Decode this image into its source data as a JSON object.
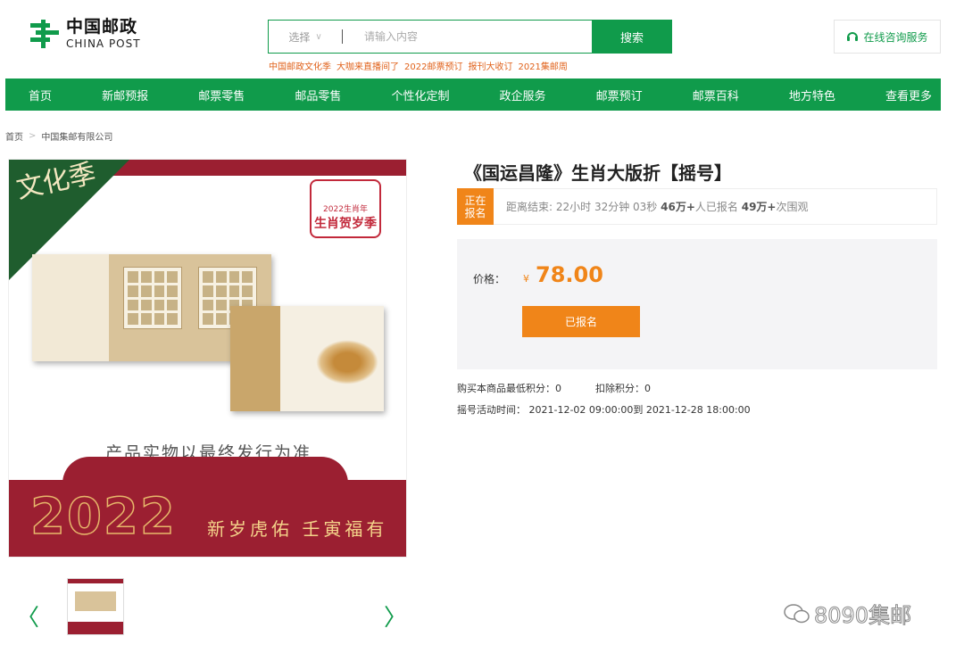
{
  "colors": {
    "brand_green": "#109b4b",
    "accent_orange": "#f08519",
    "hot_link": "#e0621b",
    "stamp_red": "#9b1f31"
  },
  "logo": {
    "cn": "中国邮政",
    "en": "CHINA POST"
  },
  "search": {
    "select_label": "选择",
    "placeholder": "请输入内容",
    "button": "搜索"
  },
  "hot_links": [
    "中国邮政文化季",
    "大咖来直播间了",
    "2022邮票预订",
    "报刊大收订",
    "2021集邮周"
  ],
  "consult": {
    "label": "在线咨询服务",
    "icon": "headset-icon"
  },
  "nav": [
    "首页",
    "新邮预报",
    "邮票零售",
    "邮品零售",
    "个性化定制",
    "政企服务",
    "邮票预订",
    "邮票百科",
    "地方特色",
    "查看更多"
  ],
  "breadcrumb": {
    "home": "首页",
    "current": "中国集邮有限公司"
  },
  "product_image": {
    "corner_text": "文化季",
    "badge_year": "2022生肖年",
    "badge_title": "生肖贺岁季",
    "caption": "产品实物以最终发行为准",
    "year": "2022",
    "slogan": "新岁虎佑 壬寅福有"
  },
  "thumbnails": {
    "prev": "〈",
    "next": "〉"
  },
  "product": {
    "title": "《国运昌隆》生肖大版折【摇号】",
    "status_tag": "正在报名",
    "countdown_prefix": "距离结束: 22小时 32分钟 03秒",
    "signups": "46万+",
    "signups_suffix": "人已报名",
    "views": "49万+",
    "views_suffix": "次围观",
    "price_label": "价格：",
    "currency": "¥",
    "price": "78.00",
    "signup_button": "已报名",
    "min_points": "购买本商品最低积分：0",
    "deduct_points": "扣除积分：0",
    "period": "摇号活动时间： 2021-12-02 09:00:00到 2021-12-28 18:00:00"
  },
  "watermark": "8090集邮"
}
